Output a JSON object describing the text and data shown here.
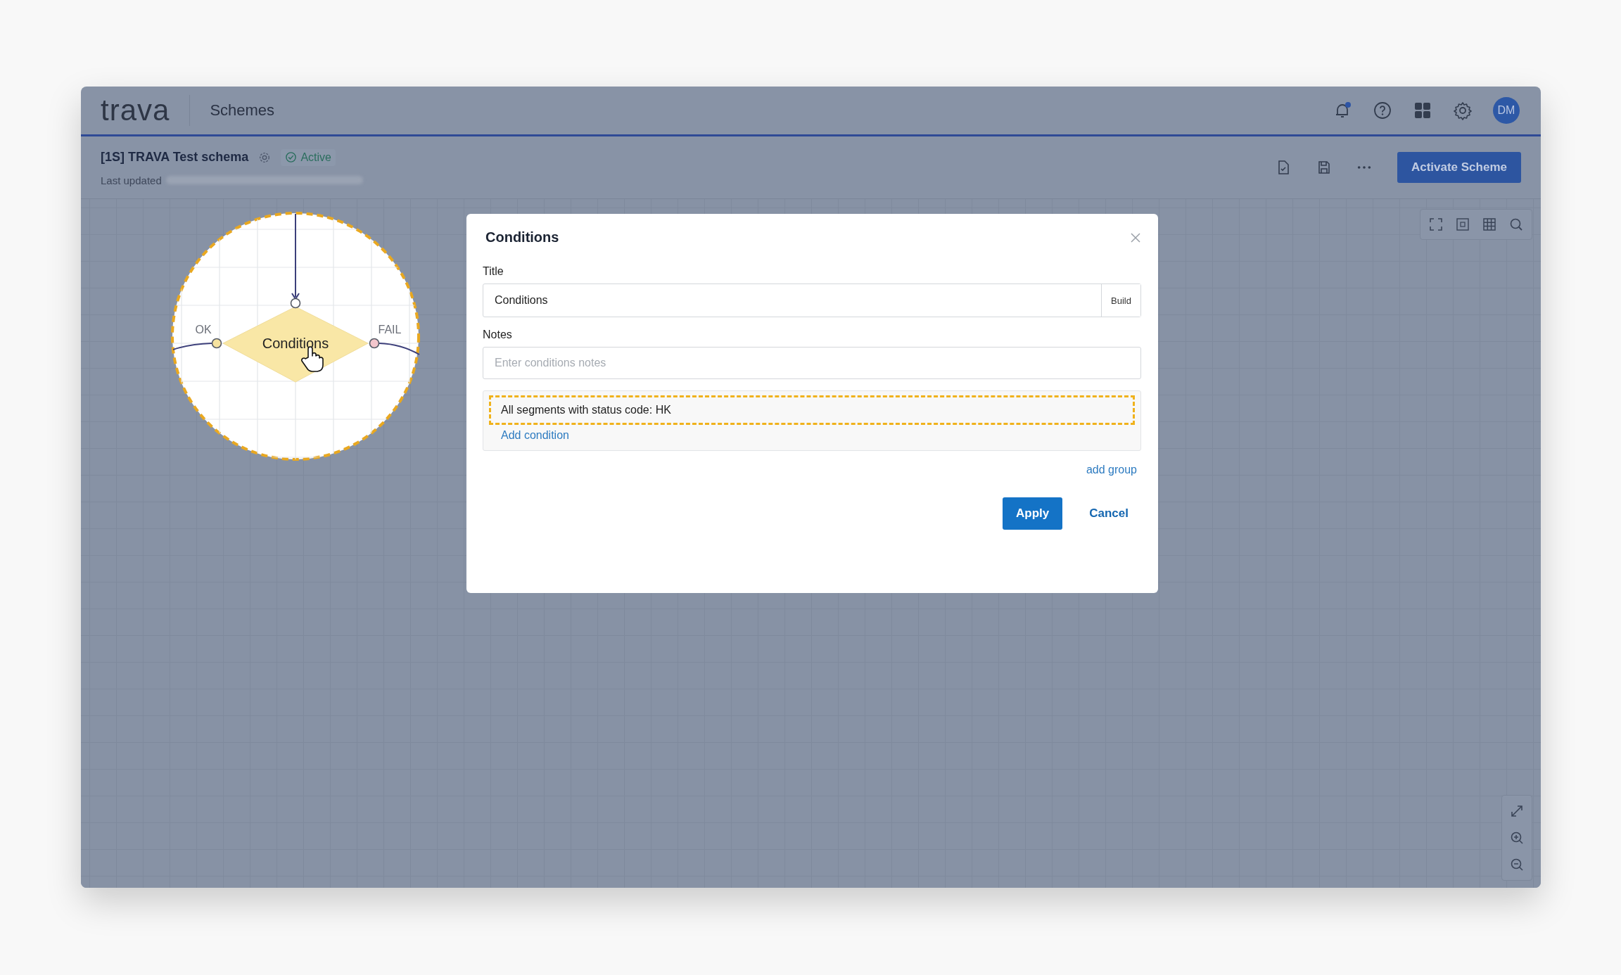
{
  "header": {
    "logo": "trava",
    "section": "Schemes",
    "avatar": "DM",
    "notification_unread": true
  },
  "scheme": {
    "title": "[1S] TRAVA Test schema",
    "status": "Active",
    "last_updated_label": "Last updated",
    "primary_action": "Activate Scheme"
  },
  "canvas": {
    "node": {
      "label": "Conditions",
      "ok_label": "OK",
      "fail_label": "FAIL"
    }
  },
  "dialog": {
    "title": "Conditions",
    "title_field": {
      "label": "Title",
      "value": "Conditions",
      "addon": "Build"
    },
    "notes_field": {
      "label": "Notes",
      "placeholder": "Enter conditions notes"
    },
    "groups": [
      {
        "conditions": [
          {
            "text": "All segments with status code: HK",
            "selected": true
          }
        ],
        "add_condition": "Add condition"
      }
    ],
    "add_group": "add group",
    "buttons": [
      {
        "label": "Apply",
        "kind": "primary"
      },
      {
        "label": "Cancel",
        "kind": "link"
      }
    ]
  }
}
